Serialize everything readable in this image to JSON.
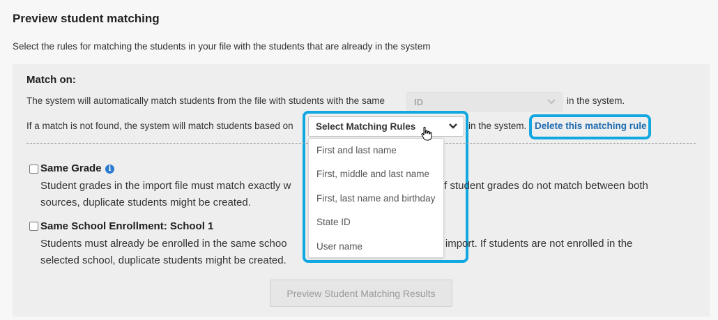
{
  "header": {
    "title": "Preview student matching",
    "subtitle": "Select the rules for matching the students in your file with the students that are already in the system"
  },
  "match": {
    "heading": "Match on:",
    "line1": "The system will automatically match students from the file with students with the same",
    "id_value": "ID",
    "line1_suffix": "in the system.",
    "line2": "If a match is not found, the system will match students based on",
    "rules_placeholder": "Select Matching Rules",
    "line2_suffix": "in the system.",
    "delete_link": "Delete this matching rule"
  },
  "dropdown": {
    "options": [
      "First and last name",
      "First, middle and last name",
      "First, last name and birthday",
      "State ID",
      "User name"
    ]
  },
  "options": [
    {
      "title": "Same Grade",
      "checked": false,
      "desc1": "Student grades in the import file must match exactly w",
      "desc1_tail": "n. If student grades do not match between both",
      "desc2": "sources, duplicate students might be created."
    },
    {
      "title": "Same School Enrollment: School 1",
      "checked": false,
      "desc1": "Students must already be enrolled in the same schoo",
      "desc1_tail": "his import. If students are not enrolled in the",
      "desc2": "selected school, duplicate students might be created."
    }
  ],
  "footer": {
    "preview_button": "Preview Student Matching Results"
  },
  "colors": {
    "highlight": "#11a8e2",
    "link": "#1c6bb0",
    "info": "#2a7ad0"
  }
}
